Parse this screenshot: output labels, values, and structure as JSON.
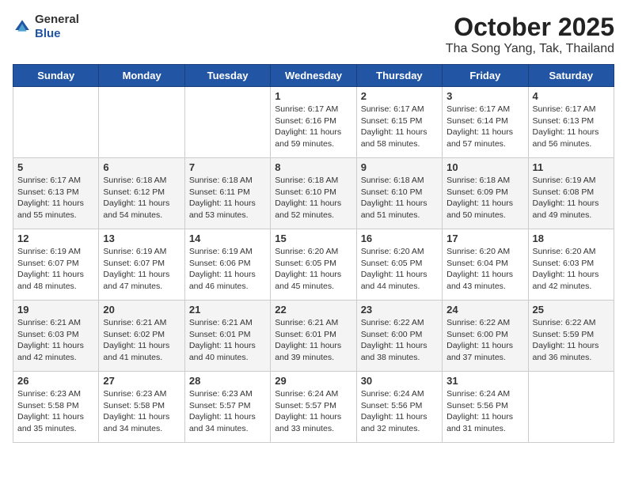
{
  "header": {
    "logo": {
      "general": "General",
      "blue": "Blue"
    },
    "month": "October 2025",
    "location": "Tha Song Yang, Tak, Thailand"
  },
  "weekdays": [
    "Sunday",
    "Monday",
    "Tuesday",
    "Wednesday",
    "Thursday",
    "Friday",
    "Saturday"
  ],
  "weeks": [
    [
      {
        "day": "",
        "sunrise": "",
        "sunset": "",
        "daylight": ""
      },
      {
        "day": "",
        "sunrise": "",
        "sunset": "",
        "daylight": ""
      },
      {
        "day": "",
        "sunrise": "",
        "sunset": "",
        "daylight": ""
      },
      {
        "day": "1",
        "sunrise": "Sunrise: 6:17 AM",
        "sunset": "Sunset: 6:16 PM",
        "daylight": "Daylight: 11 hours and 59 minutes."
      },
      {
        "day": "2",
        "sunrise": "Sunrise: 6:17 AM",
        "sunset": "Sunset: 6:15 PM",
        "daylight": "Daylight: 11 hours and 58 minutes."
      },
      {
        "day": "3",
        "sunrise": "Sunrise: 6:17 AM",
        "sunset": "Sunset: 6:14 PM",
        "daylight": "Daylight: 11 hours and 57 minutes."
      },
      {
        "day": "4",
        "sunrise": "Sunrise: 6:17 AM",
        "sunset": "Sunset: 6:13 PM",
        "daylight": "Daylight: 11 hours and 56 minutes."
      }
    ],
    [
      {
        "day": "5",
        "sunrise": "Sunrise: 6:17 AM",
        "sunset": "Sunset: 6:13 PM",
        "daylight": "Daylight: 11 hours and 55 minutes."
      },
      {
        "day": "6",
        "sunrise": "Sunrise: 6:18 AM",
        "sunset": "Sunset: 6:12 PM",
        "daylight": "Daylight: 11 hours and 54 minutes."
      },
      {
        "day": "7",
        "sunrise": "Sunrise: 6:18 AM",
        "sunset": "Sunset: 6:11 PM",
        "daylight": "Daylight: 11 hours and 53 minutes."
      },
      {
        "day": "8",
        "sunrise": "Sunrise: 6:18 AM",
        "sunset": "Sunset: 6:10 PM",
        "daylight": "Daylight: 11 hours and 52 minutes."
      },
      {
        "day": "9",
        "sunrise": "Sunrise: 6:18 AM",
        "sunset": "Sunset: 6:10 PM",
        "daylight": "Daylight: 11 hours and 51 minutes."
      },
      {
        "day": "10",
        "sunrise": "Sunrise: 6:18 AM",
        "sunset": "Sunset: 6:09 PM",
        "daylight": "Daylight: 11 hours and 50 minutes."
      },
      {
        "day": "11",
        "sunrise": "Sunrise: 6:19 AM",
        "sunset": "Sunset: 6:08 PM",
        "daylight": "Daylight: 11 hours and 49 minutes."
      }
    ],
    [
      {
        "day": "12",
        "sunrise": "Sunrise: 6:19 AM",
        "sunset": "Sunset: 6:07 PM",
        "daylight": "Daylight: 11 hours and 48 minutes."
      },
      {
        "day": "13",
        "sunrise": "Sunrise: 6:19 AM",
        "sunset": "Sunset: 6:07 PM",
        "daylight": "Daylight: 11 hours and 47 minutes."
      },
      {
        "day": "14",
        "sunrise": "Sunrise: 6:19 AM",
        "sunset": "Sunset: 6:06 PM",
        "daylight": "Daylight: 11 hours and 46 minutes."
      },
      {
        "day": "15",
        "sunrise": "Sunrise: 6:20 AM",
        "sunset": "Sunset: 6:05 PM",
        "daylight": "Daylight: 11 hours and 45 minutes."
      },
      {
        "day": "16",
        "sunrise": "Sunrise: 6:20 AM",
        "sunset": "Sunset: 6:05 PM",
        "daylight": "Daylight: 11 hours and 44 minutes."
      },
      {
        "day": "17",
        "sunrise": "Sunrise: 6:20 AM",
        "sunset": "Sunset: 6:04 PM",
        "daylight": "Daylight: 11 hours and 43 minutes."
      },
      {
        "day": "18",
        "sunrise": "Sunrise: 6:20 AM",
        "sunset": "Sunset: 6:03 PM",
        "daylight": "Daylight: 11 hours and 42 minutes."
      }
    ],
    [
      {
        "day": "19",
        "sunrise": "Sunrise: 6:21 AM",
        "sunset": "Sunset: 6:03 PM",
        "daylight": "Daylight: 11 hours and 42 minutes."
      },
      {
        "day": "20",
        "sunrise": "Sunrise: 6:21 AM",
        "sunset": "Sunset: 6:02 PM",
        "daylight": "Daylight: 11 hours and 41 minutes."
      },
      {
        "day": "21",
        "sunrise": "Sunrise: 6:21 AM",
        "sunset": "Sunset: 6:01 PM",
        "daylight": "Daylight: 11 hours and 40 minutes."
      },
      {
        "day": "22",
        "sunrise": "Sunrise: 6:21 AM",
        "sunset": "Sunset: 6:01 PM",
        "daylight": "Daylight: 11 hours and 39 minutes."
      },
      {
        "day": "23",
        "sunrise": "Sunrise: 6:22 AM",
        "sunset": "Sunset: 6:00 PM",
        "daylight": "Daylight: 11 hours and 38 minutes."
      },
      {
        "day": "24",
        "sunrise": "Sunrise: 6:22 AM",
        "sunset": "Sunset: 6:00 PM",
        "daylight": "Daylight: 11 hours and 37 minutes."
      },
      {
        "day": "25",
        "sunrise": "Sunrise: 6:22 AM",
        "sunset": "Sunset: 5:59 PM",
        "daylight": "Daylight: 11 hours and 36 minutes."
      }
    ],
    [
      {
        "day": "26",
        "sunrise": "Sunrise: 6:23 AM",
        "sunset": "Sunset: 5:58 PM",
        "daylight": "Daylight: 11 hours and 35 minutes."
      },
      {
        "day": "27",
        "sunrise": "Sunrise: 6:23 AM",
        "sunset": "Sunset: 5:58 PM",
        "daylight": "Daylight: 11 hours and 34 minutes."
      },
      {
        "day": "28",
        "sunrise": "Sunrise: 6:23 AM",
        "sunset": "Sunset: 5:57 PM",
        "daylight": "Daylight: 11 hours and 34 minutes."
      },
      {
        "day": "29",
        "sunrise": "Sunrise: 6:24 AM",
        "sunset": "Sunset: 5:57 PM",
        "daylight": "Daylight: 11 hours and 33 minutes."
      },
      {
        "day": "30",
        "sunrise": "Sunrise: 6:24 AM",
        "sunset": "Sunset: 5:56 PM",
        "daylight": "Daylight: 11 hours and 32 minutes."
      },
      {
        "day": "31",
        "sunrise": "Sunrise: 6:24 AM",
        "sunset": "Sunset: 5:56 PM",
        "daylight": "Daylight: 11 hours and 31 minutes."
      },
      {
        "day": "",
        "sunrise": "",
        "sunset": "",
        "daylight": ""
      }
    ]
  ]
}
